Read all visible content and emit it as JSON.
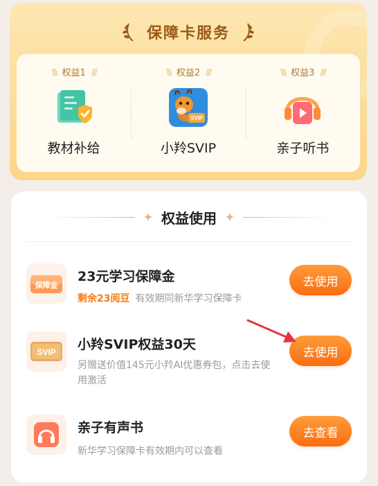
{
  "service": {
    "title": "保障卡服务",
    "benefits": [
      {
        "tag": "权益1",
        "label": "教材补给",
        "icon": "textbook-shield-icon"
      },
      {
        "tag": "权益2",
        "label": "小羚SVIP",
        "icon": "antelope-svip-icon"
      },
      {
        "tag": "权益3",
        "label": "亲子听书",
        "icon": "headphones-play-icon"
      }
    ]
  },
  "usage": {
    "title": "权益使用",
    "items": [
      {
        "icon_text": "保障金",
        "title": "23元学习保障金",
        "highlight": "剩余23阅豆",
        "note": "有效期同新华学习保障卡",
        "button": "去使用"
      },
      {
        "icon_text": "SVIP",
        "title": "小羚SVIP权益30天",
        "desc": "另赠送价值145元小羚AI优惠券包，点击去使用激活",
        "button": "去使用"
      },
      {
        "icon_text": "",
        "title": "亲子有声书",
        "desc": "新华学习保障卡有效期内可以查看",
        "button": "去查看"
      }
    ]
  },
  "colors": {
    "accent_orange": "#fb6d12",
    "gold_bg": "#fcd58a",
    "title_brown": "#9a5a14",
    "annotation_arrow": "#e8333f"
  }
}
